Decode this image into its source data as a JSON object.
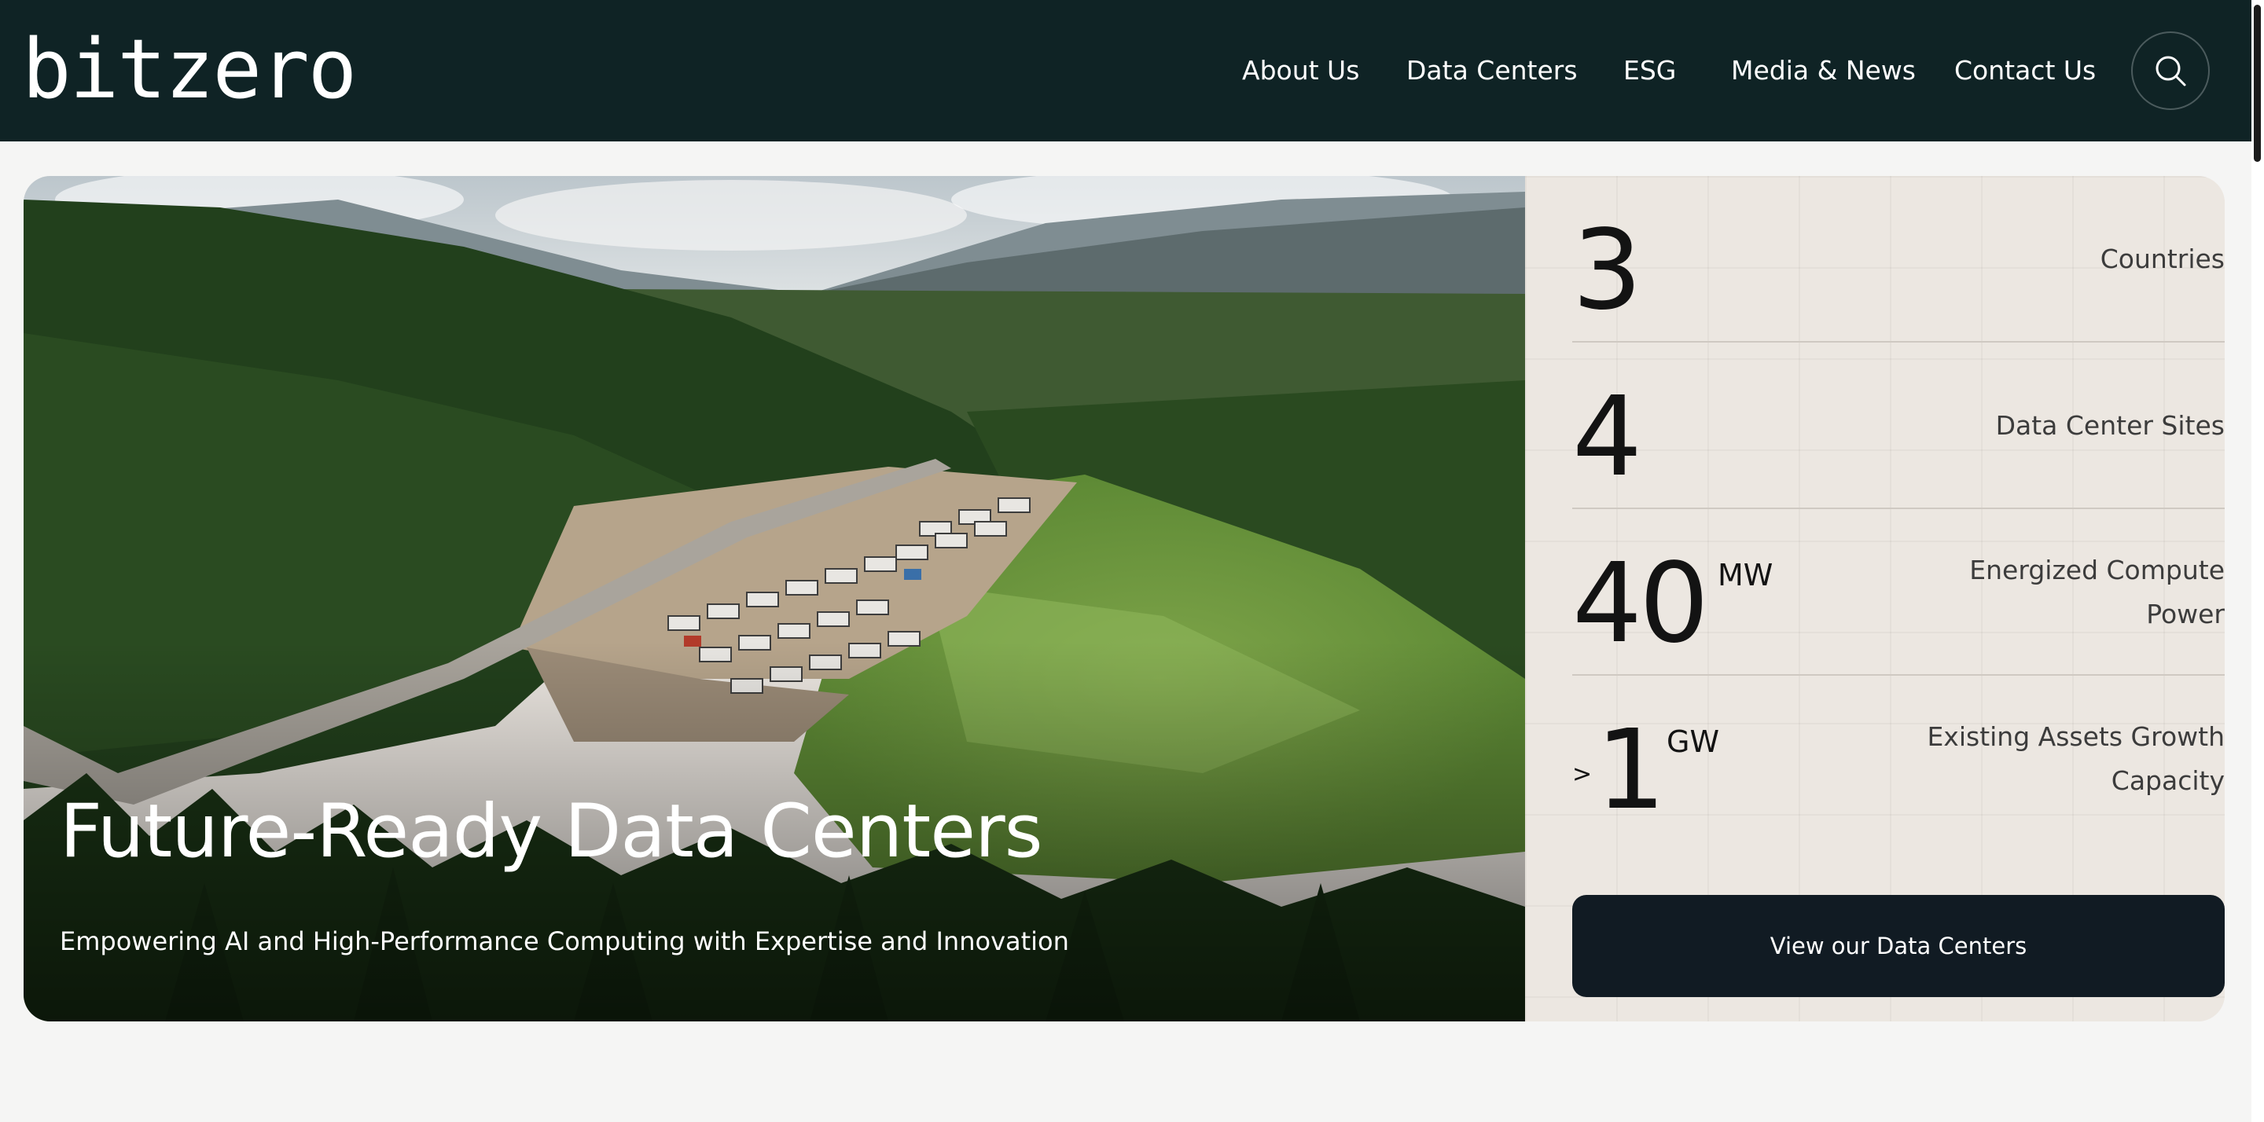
{
  "header": {
    "logo": "bitzero",
    "nav": [
      {
        "label": "About Us"
      },
      {
        "label": "Data Centers"
      },
      {
        "label": "ESG"
      },
      {
        "label": "Media & News"
      },
      {
        "label": "Contact Us"
      }
    ],
    "search_icon": "search-icon"
  },
  "hero": {
    "title": "Future-Ready Data Centers",
    "subtitle": "Empowering AI and High-Performance Computing with Expertise and Innovation",
    "image": "aerial-forest-data-center-photo"
  },
  "stats": [
    {
      "prefix": "",
      "value": "3",
      "unit": "",
      "label": "Countries"
    },
    {
      "prefix": "",
      "value": "4",
      "unit": "",
      "label": "Data Center Sites"
    },
    {
      "prefix": "",
      "value": "40",
      "unit": "MW",
      "label": "Energized Compute Power"
    },
    {
      "prefix": ">",
      "value": "1",
      "unit": "GW",
      "label": "Existing Assets Growth Capacity"
    }
  ],
  "cta": {
    "label": "View our Data Centers"
  },
  "colors": {
    "header_bg": "#0f2325",
    "panel_bg": "#ece7e1",
    "button_bg": "#111b23"
  }
}
